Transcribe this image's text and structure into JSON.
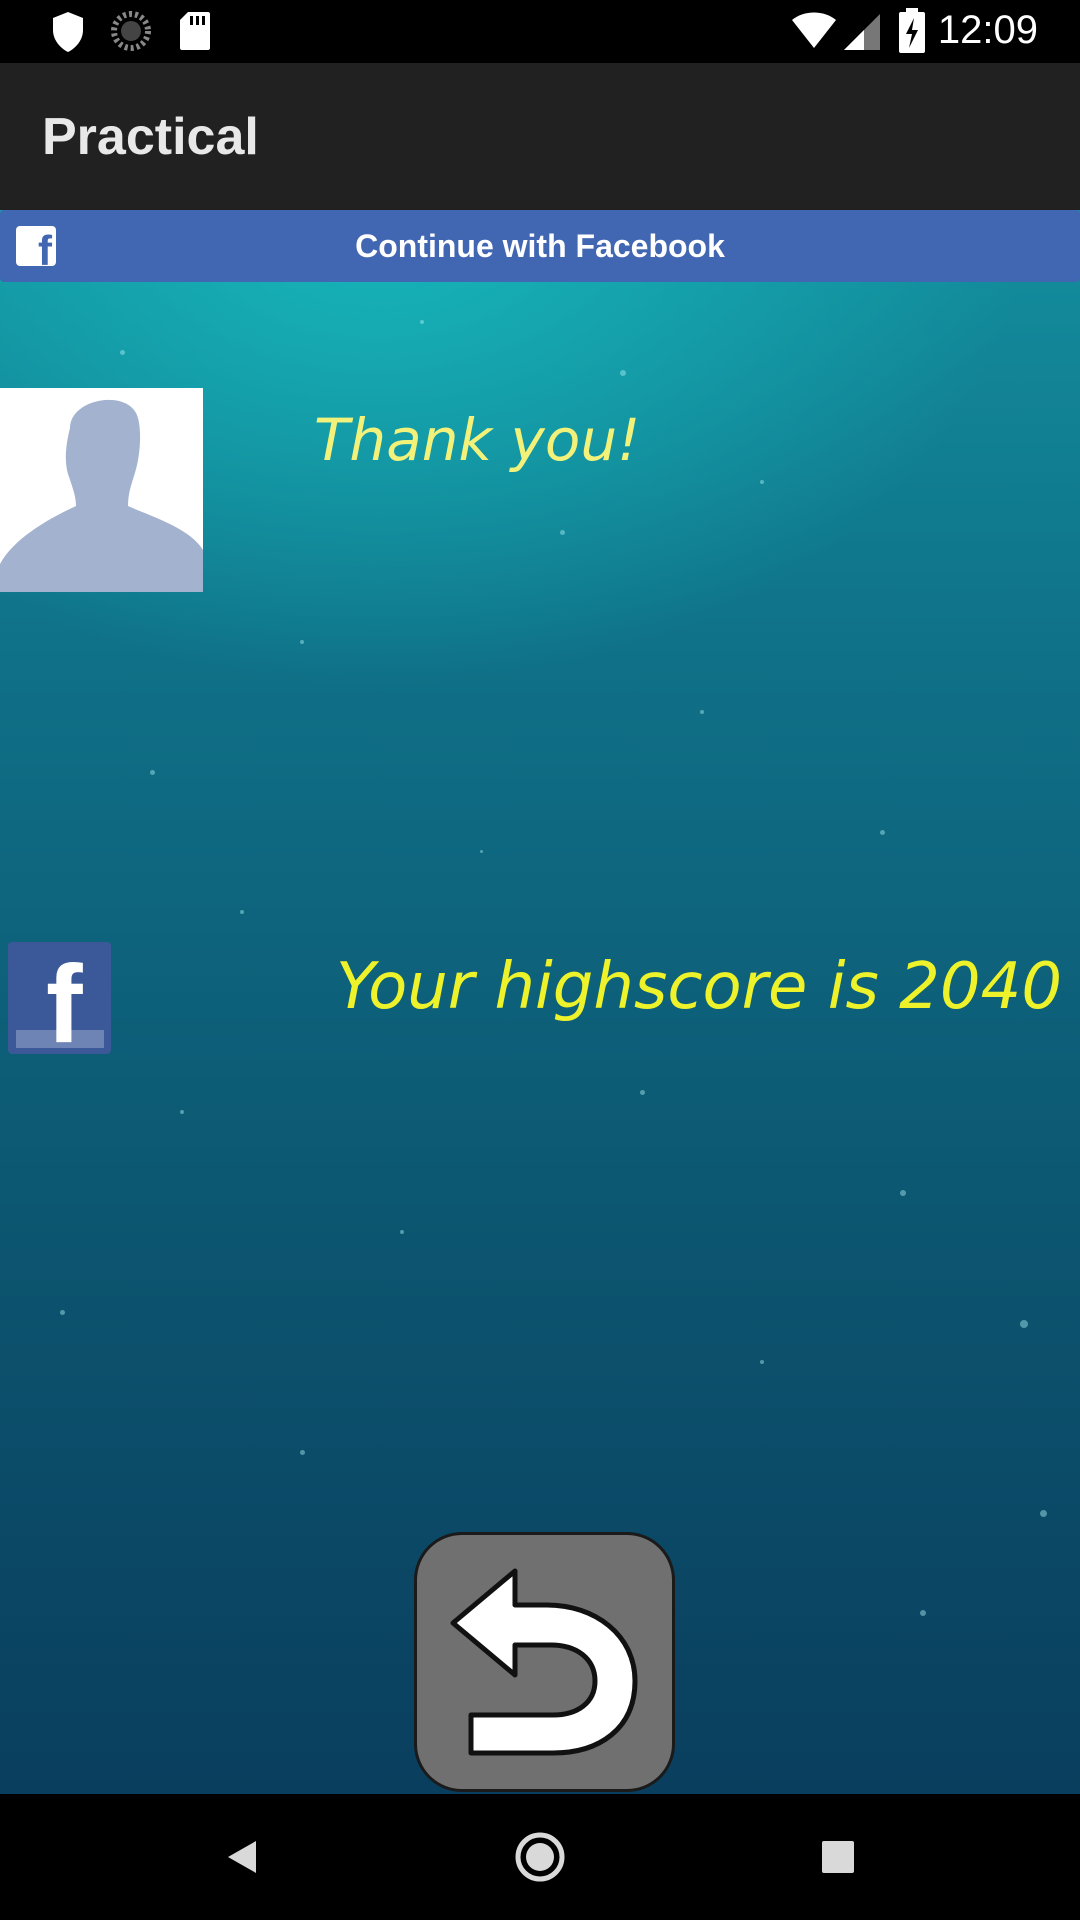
{
  "status_bar": {
    "time": "12:09",
    "left_icons": [
      "shield-icon",
      "sync-icon",
      "sd-card-icon"
    ],
    "right_icons": [
      "wifi-icon",
      "signal-icon",
      "battery-charging-icon"
    ]
  },
  "app_bar": {
    "title": "Practical"
  },
  "facebook_login": {
    "label": "Continue with Facebook",
    "icon": "facebook-icon",
    "color": "#4267b2"
  },
  "profile": {
    "avatar_icon": "default-profile-silhouette",
    "message": "Thank you!"
  },
  "score": {
    "text": "Your highscore is 2040",
    "color": "#eef22a"
  },
  "share": {
    "icon": "facebook-share-icon"
  },
  "back_button": {
    "icon": "undo-arrow-icon"
  },
  "nav_bar": {
    "buttons": [
      "back-triangle-icon",
      "home-circle-icon",
      "recents-square-icon"
    ]
  }
}
